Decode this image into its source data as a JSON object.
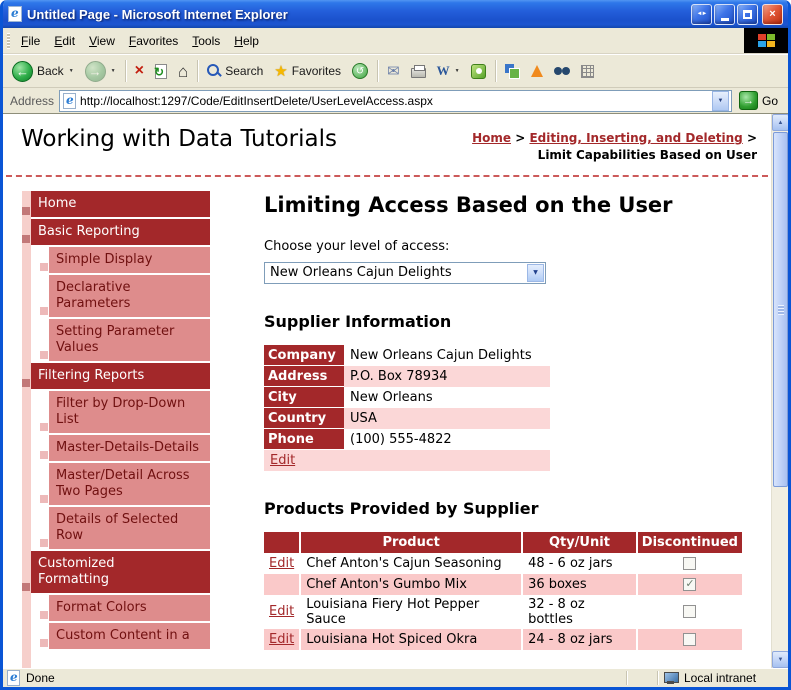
{
  "colors": {
    "accent_dark_red": "#A3282A",
    "sidebar_sub_pink": "#DE8C8C",
    "supplier_row_pink": "#FBD7D7",
    "products_row_pink": "#FAC9C9",
    "titlebar_blue": "#245FDB",
    "chrome_tan": "#ECE9D8"
  },
  "window": {
    "title": "Untitled Page - Microsoft Internet Explorer"
  },
  "menu": {
    "items": [
      "File",
      "Edit",
      "View",
      "Favorites",
      "Tools",
      "Help"
    ]
  },
  "toolbar": {
    "back": "Back",
    "search": "Search",
    "favorites": "Favorites"
  },
  "address": {
    "label": "Address",
    "url": "http://localhost:1297/Code/EditInsertDelete/UserLevelAccess.aspx",
    "go": "Go"
  },
  "statusbar": {
    "left": "Done",
    "right": "Local intranet"
  },
  "page": {
    "site_title": "Working with Data Tutorials",
    "breadcrumb": {
      "home": "Home",
      "sep1": ">",
      "section": "Editing, Inserting, and Deleting",
      "sep2": ">",
      "current": "Limit Capabilities Based on User"
    },
    "sidebar": [
      {
        "label": "Home",
        "level": "top"
      },
      {
        "label": "Basic Reporting",
        "level": "top"
      },
      {
        "label": "Simple Display",
        "level": "sub"
      },
      {
        "label": "Declarative Parameters",
        "level": "sub"
      },
      {
        "label": "Setting Parameter Values",
        "level": "sub"
      },
      {
        "label": "Filtering Reports",
        "level": "top"
      },
      {
        "label": "Filter by Drop-Down List",
        "level": "sub"
      },
      {
        "label": "Master-Details-Details",
        "level": "sub"
      },
      {
        "label": "Master/Detail Across Two Pages",
        "level": "sub"
      },
      {
        "label": "Details of Selected Row",
        "level": "sub"
      },
      {
        "label": "Customized Formatting",
        "level": "top"
      },
      {
        "label": "Format Colors",
        "level": "sub"
      },
      {
        "label": "Custom Content in a",
        "level": "sub"
      }
    ],
    "main": {
      "title": "Limiting Access Based on the User",
      "access_label": "Choose your level of access:",
      "dropdown_value": "New Orleans Cajun Delights",
      "supplier_heading": "Supplier Information",
      "supplier_rows": [
        {
          "label": "Company",
          "value": "New Orleans Cajun Delights"
        },
        {
          "label": "Address",
          "value": "P.O. Box 78934"
        },
        {
          "label": "City",
          "value": "New Orleans"
        },
        {
          "label": "Country",
          "value": "USA"
        },
        {
          "label": "Phone",
          "value": "(100) 555-4822"
        }
      ],
      "supplier_edit": "Edit",
      "products_heading": "Products Provided by Supplier",
      "products_headers": [
        "",
        "Product",
        "Qty/Unit",
        "Discontinued"
      ],
      "products_rows": [
        {
          "edit": "Edit",
          "product": "Chef Anton's Cajun Seasoning",
          "qty": "48 - 6 oz jars",
          "discontinued": false
        },
        {
          "edit": "",
          "product": "Chef Anton's Gumbo Mix",
          "qty": "36 boxes",
          "discontinued": true
        },
        {
          "edit": "Edit",
          "product": "Louisiana Fiery Hot Pepper Sauce",
          "qty": "32 - 8 oz bottles",
          "discontinued": false
        },
        {
          "edit": "Edit",
          "product": "Louisiana Hot Spiced Okra",
          "qty": "24 - 8 oz jars",
          "discontinued": false
        }
      ]
    }
  }
}
